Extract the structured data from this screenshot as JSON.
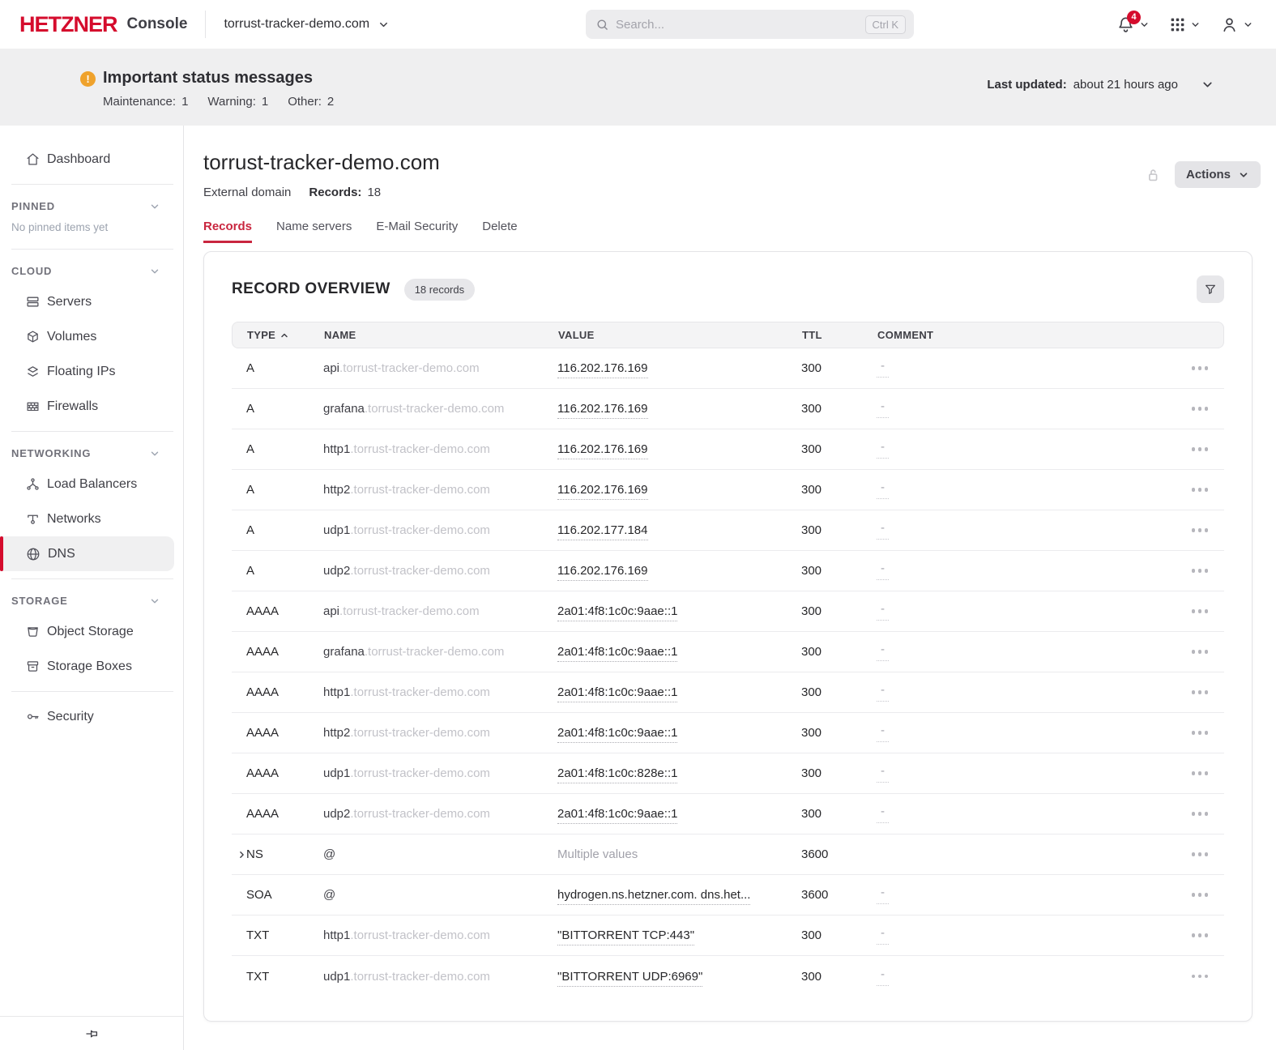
{
  "accent_color": "#d50c2d",
  "header": {
    "logo": "HETZNER",
    "product": "Console",
    "domain_selector": "torrust-tracker-demo.com",
    "search": {
      "placeholder": "Search...",
      "shortcut": "Ctrl K"
    },
    "notifications_badge": "4"
  },
  "status_banner": {
    "title": "Important status messages",
    "counts": [
      {
        "label": "Maintenance:",
        "value": "1"
      },
      {
        "label": "Warning:",
        "value": "1"
      },
      {
        "label": "Other:",
        "value": "2"
      }
    ],
    "last_updated_label": "Last updated:",
    "last_updated_value": "about 21 hours ago"
  },
  "sidebar": {
    "dashboard": "Dashboard",
    "pinned": {
      "heading": "PINNED",
      "empty": "No pinned items yet"
    },
    "cloud": {
      "heading": "CLOUD",
      "items": [
        "Servers",
        "Volumes",
        "Floating IPs",
        "Firewalls"
      ]
    },
    "networking": {
      "heading": "NETWORKING",
      "items": [
        "Load Balancers",
        "Networks",
        "DNS"
      ]
    },
    "storage": {
      "heading": "STORAGE",
      "items": [
        "Object Storage",
        "Storage Boxes"
      ]
    },
    "security": "Security"
  },
  "main": {
    "title": "torrust-tracker-demo.com",
    "domain_type": "External domain",
    "records_label": "Records:",
    "records_count": "18",
    "actions_label": "Actions",
    "tabs": [
      "Records",
      "Name servers",
      "E-Mail Security",
      "Delete"
    ],
    "card": {
      "heading": "RECORD OVERVIEW",
      "badge": "18 records",
      "columns": [
        "TYPE",
        "NAME",
        "VALUE",
        "TTL",
        "COMMENT"
      ],
      "rows": [
        {
          "type": "A",
          "name": "api",
          "name_suffix": ".torrust-tracker-demo.com",
          "value": "116.202.176.169",
          "ttl": "300",
          "comment": "-"
        },
        {
          "type": "A",
          "name": "grafana",
          "name_suffix": ".torrust-tracker-demo.com",
          "value": "116.202.176.169",
          "ttl": "300",
          "comment": "-"
        },
        {
          "type": "A",
          "name": "http1",
          "name_suffix": ".torrust-tracker-demo.com",
          "value": "116.202.176.169",
          "ttl": "300",
          "comment": "-"
        },
        {
          "type": "A",
          "name": "http2",
          "name_suffix": ".torrust-tracker-demo.com",
          "value": "116.202.176.169",
          "ttl": "300",
          "comment": "-"
        },
        {
          "type": "A",
          "name": "udp1",
          "name_suffix": ".torrust-tracker-demo.com",
          "value": "116.202.177.184",
          "ttl": "300",
          "comment": "-"
        },
        {
          "type": "A",
          "name": "udp2",
          "name_suffix": ".torrust-tracker-demo.com",
          "value": "116.202.176.169",
          "ttl": "300",
          "comment": "-"
        },
        {
          "type": "AAAA",
          "name": "api",
          "name_suffix": ".torrust-tracker-demo.com",
          "value": "2a01:4f8:1c0c:9aae::1",
          "ttl": "300",
          "comment": "-"
        },
        {
          "type": "AAAA",
          "name": "grafana",
          "name_suffix": ".torrust-tracker-demo.com",
          "value": "2a01:4f8:1c0c:9aae::1",
          "ttl": "300",
          "comment": "-"
        },
        {
          "type": "AAAA",
          "name": "http1",
          "name_suffix": ".torrust-tracker-demo.com",
          "value": "2a01:4f8:1c0c:9aae::1",
          "ttl": "300",
          "comment": "-"
        },
        {
          "type": "AAAA",
          "name": "http2",
          "name_suffix": ".torrust-tracker-demo.com",
          "value": "2a01:4f8:1c0c:9aae::1",
          "ttl": "300",
          "comment": "-"
        },
        {
          "type": "AAAA",
          "name": "udp1",
          "name_suffix": ".torrust-tracker-demo.com",
          "value": "2a01:4f8:1c0c:828e::1",
          "ttl": "300",
          "comment": "-"
        },
        {
          "type": "AAAA",
          "name": "udp2",
          "name_suffix": ".torrust-tracker-demo.com",
          "value": "2a01:4f8:1c0c:9aae::1",
          "ttl": "300",
          "comment": "-"
        },
        {
          "type": "NS",
          "name": "@",
          "name_suffix": "",
          "value": "Multiple values",
          "value_muted": true,
          "ttl": "3600",
          "comment": "",
          "expandable": true
        },
        {
          "type": "SOA",
          "name": "@",
          "name_suffix": "",
          "value": "hydrogen.ns.hetzner.com. dns.het...",
          "ttl": "3600",
          "comment": "-"
        },
        {
          "type": "TXT",
          "name": "http1",
          "name_suffix": ".torrust-tracker-demo.com",
          "value": "\"BITTORRENT TCP:443\"",
          "ttl": "300",
          "comment": "-"
        },
        {
          "type": "TXT",
          "name": "udp1",
          "name_suffix": ".torrust-tracker-demo.com",
          "value": "\"BITTORRENT UDP:6969\"",
          "ttl": "300",
          "comment": "-"
        }
      ]
    }
  }
}
